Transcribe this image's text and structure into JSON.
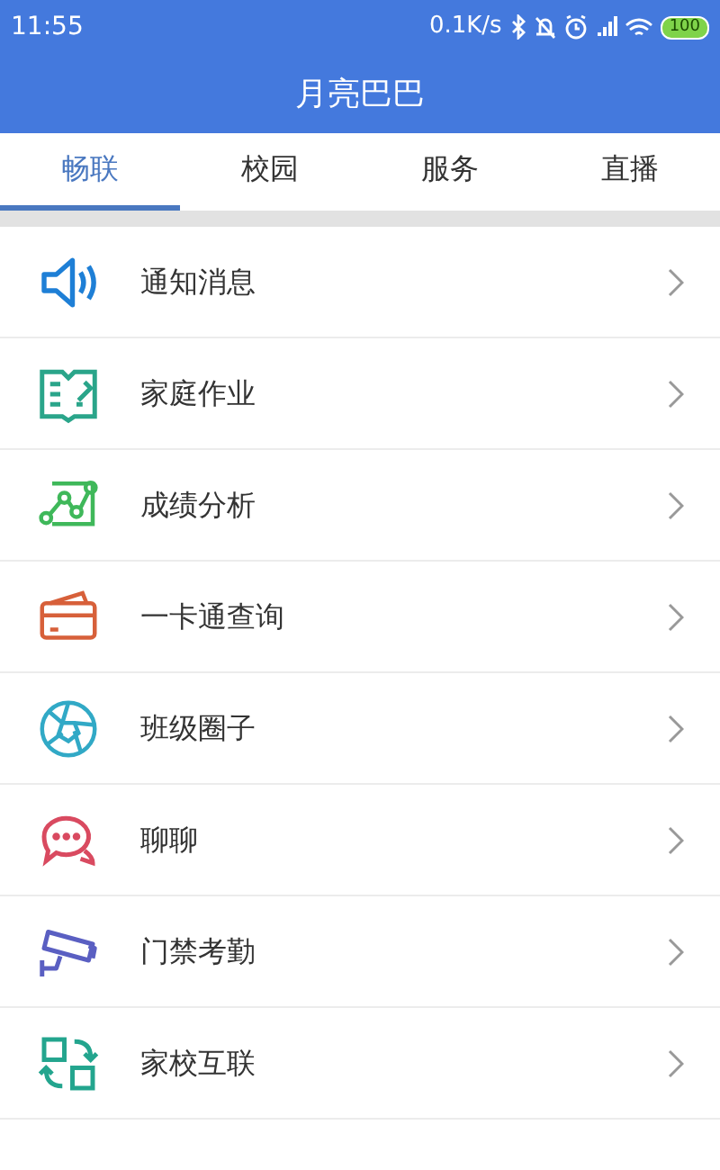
{
  "status_bar": {
    "time": "11:55",
    "speed": "0.1K/s",
    "battery": "100"
  },
  "header": {
    "title": "月亮巴巴"
  },
  "tabs": [
    {
      "label": "畅联",
      "selected": true
    },
    {
      "label": "校园",
      "selected": false
    },
    {
      "label": "服务",
      "selected": false
    },
    {
      "label": "直播",
      "selected": false
    }
  ],
  "menu": [
    {
      "label": "通知消息"
    },
    {
      "label": "家庭作业"
    },
    {
      "label": "成绩分析"
    },
    {
      "label": "一卡通查询"
    },
    {
      "label": "班级圈子"
    },
    {
      "label": "聊聊"
    },
    {
      "label": "门禁考勤"
    },
    {
      "label": "家校互联"
    }
  ]
}
